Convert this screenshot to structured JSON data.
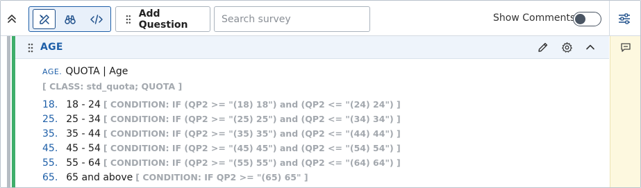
{
  "toolbar": {
    "add_question_label": "Add Question",
    "search_placeholder": "Search survey",
    "search_value": "",
    "show_comments_label": "Show Comments",
    "show_comments_on": false,
    "modes": [
      {
        "icon": "edit-tools-icon",
        "active": true
      },
      {
        "icon": "binoculars-icon",
        "active": false
      },
      {
        "icon": "code-icon",
        "active": false
      }
    ]
  },
  "question": {
    "title": "AGE",
    "code": "AGE.",
    "text": "QUOTA | Age",
    "class_line": "[ CLASS: std_quota; QUOTA ]",
    "options": [
      {
        "code": "18.",
        "label": "18 - 24",
        "condition": "[ CONDITION: IF (QP2 >= \"(18) 18\") and (QP2 <= \"(24) 24\") ]"
      },
      {
        "code": "25.",
        "label": "25 - 34",
        "condition": "[ CONDITION: IF (QP2 >= \"(25) 25\") and (QP2 <= \"(34) 34\") ]"
      },
      {
        "code": "35.",
        "label": "35 - 44",
        "condition": "[ CONDITION: IF (QP2 >= \"(35) 35\") and (QP2 <= \"(44) 44\") ]"
      },
      {
        "code": "45.",
        "label": "45 - 54",
        "condition": "[ CONDITION: IF (QP2 >= \"(45) 45\") and (QP2 <= \"(54) 54\") ]"
      },
      {
        "code": "55.",
        "label": "55 - 64",
        "condition": "[ CONDITION: IF (QP2 >= \"(55) 55\") and (QP2 <= \"(64) 64\") ]"
      },
      {
        "code": "65.",
        "label": "65 and above",
        "condition": "[ CONDITION: IF QP2 >= \"(65) 65\" ]"
      }
    ]
  },
  "colors": {
    "accent": "#1e5fa8",
    "status_bar": "#3fae6b",
    "comments_bg": "#fdf8df",
    "meta_text": "#a3a8ae"
  }
}
